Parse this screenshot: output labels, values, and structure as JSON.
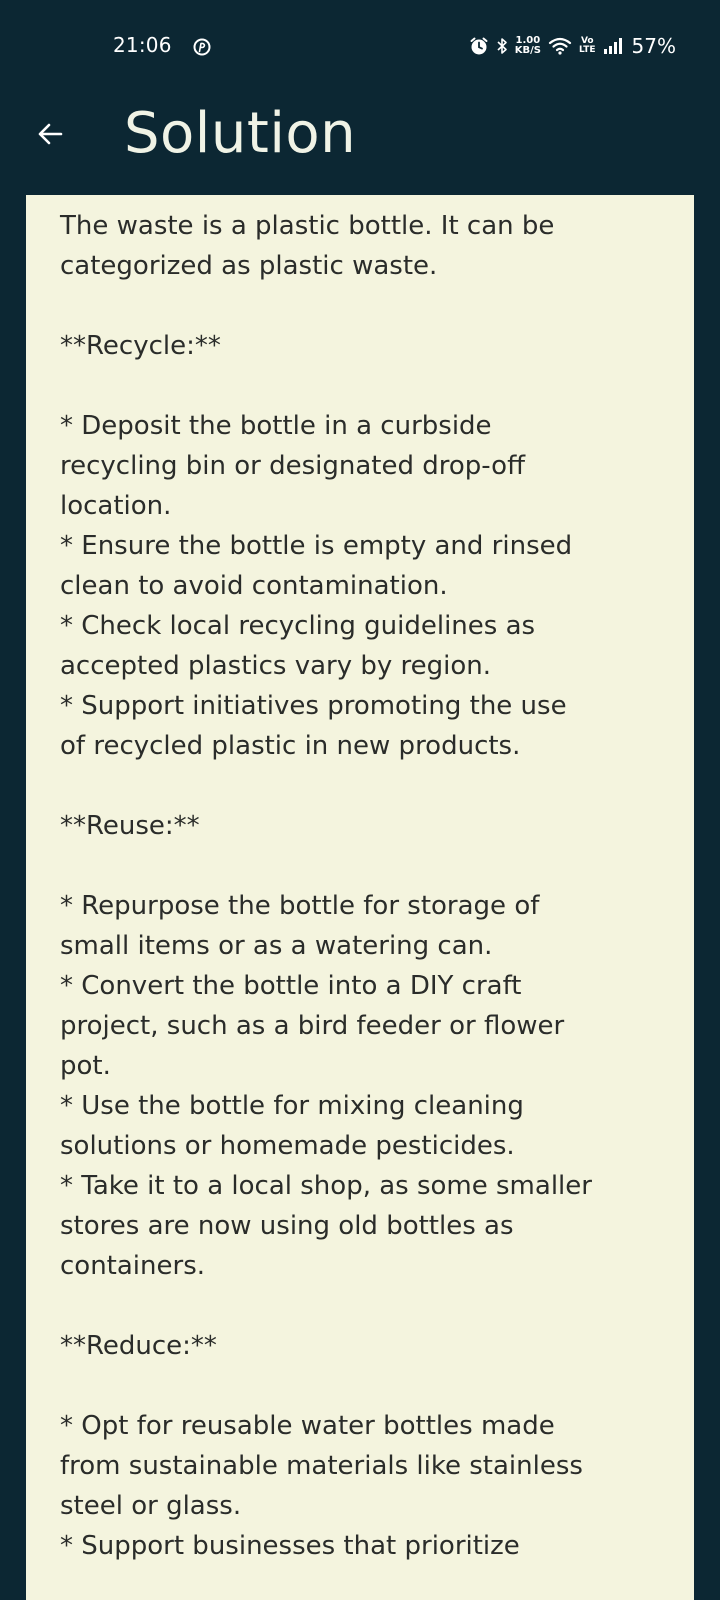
{
  "status_bar": {
    "time": "21:06",
    "net_speed_value": "1.00",
    "net_speed_unit": "KB/S",
    "volte_top": "Vo",
    "volte_bottom": "LTE",
    "battery": "57%"
  },
  "app_bar": {
    "back_icon": "arrow-left-icon",
    "title": "Solution"
  },
  "solution": {
    "text": "The waste is a plastic bottle. It can be\ncategorized as plastic waste.\n\n**Recycle:**\n\n* Deposit the bottle in a curbside\nrecycling bin or designated drop-off\nlocation.\n* Ensure the bottle is empty and rinsed\nclean to avoid contamination.\n* Check local recycling guidelines as\naccepted plastics vary by region.\n* Support initiatives promoting the use\nof recycled plastic in new products.\n\n**Reuse:**\n\n* Repurpose the bottle for storage of\nsmall items or as a watering can.\n* Convert the bottle into a DIY craft\nproject, such as a bird feeder or flower\npot.\n* Use the bottle for mixing cleaning\nsolutions or homemade pesticides.\n* Take it to a local shop, as some smaller\nstores are now using old bottles as\ncontainers.\n\n**Reduce:**\n\n* Opt for reusable water bottles made\nfrom sustainable materials like stainless\nsteel or glass.\n* Support businesses that prioritize"
  },
  "colors": {
    "background": "#0c2733",
    "card": "#f4f4de",
    "text": "#2a2c2a",
    "title": "#f0f3e6"
  }
}
